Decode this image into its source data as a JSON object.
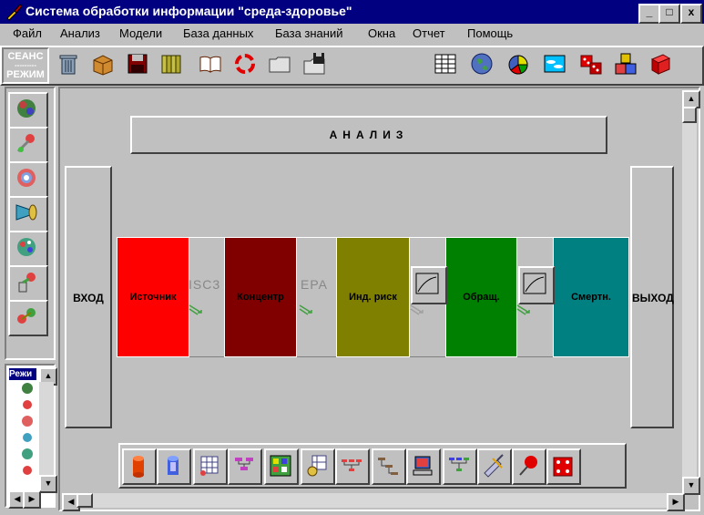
{
  "window": {
    "title": "Система обработки информации \"среда-здоровье\"",
    "controls": {
      "minimize": "_",
      "maximize": "□",
      "close": "x"
    }
  },
  "menu": [
    {
      "label": "Файл"
    },
    {
      "label": "Анализ"
    },
    {
      "label": "Модели"
    },
    {
      "label": "База данных"
    },
    {
      "label": "База знаний"
    },
    {
      "label": "Окна"
    },
    {
      "label": "Отчет"
    },
    {
      "label": "Помощь"
    }
  ],
  "toolbar": {
    "session": {
      "line1": "СЕАНС",
      "line2": "---------",
      "line3": "РЕЖИМ"
    }
  },
  "mode_panel": {
    "label": "Режи"
  },
  "workspace": {
    "analysis_title": "АНАЛИЗ",
    "input_label": "ВХОД",
    "output_label": "ВЫХОД",
    "blocks": [
      {
        "label": "Источник",
        "color": "#ff0000"
      },
      {
        "label": "Концентр",
        "color": "#800000"
      },
      {
        "label": "Инд. риск",
        "color": "#808000"
      },
      {
        "label": "Обращ.",
        "color": "#008000"
      },
      {
        "label": "Смертн.",
        "color": "#008080"
      }
    ],
    "connectors": [
      {
        "label": "ISC3"
      },
      {
        "label": "EPA"
      },
      {
        "label": ""
      },
      {
        "label": ""
      }
    ]
  },
  "colors": {
    "titlebar": "#000080",
    "face": "#c0c0c0"
  }
}
